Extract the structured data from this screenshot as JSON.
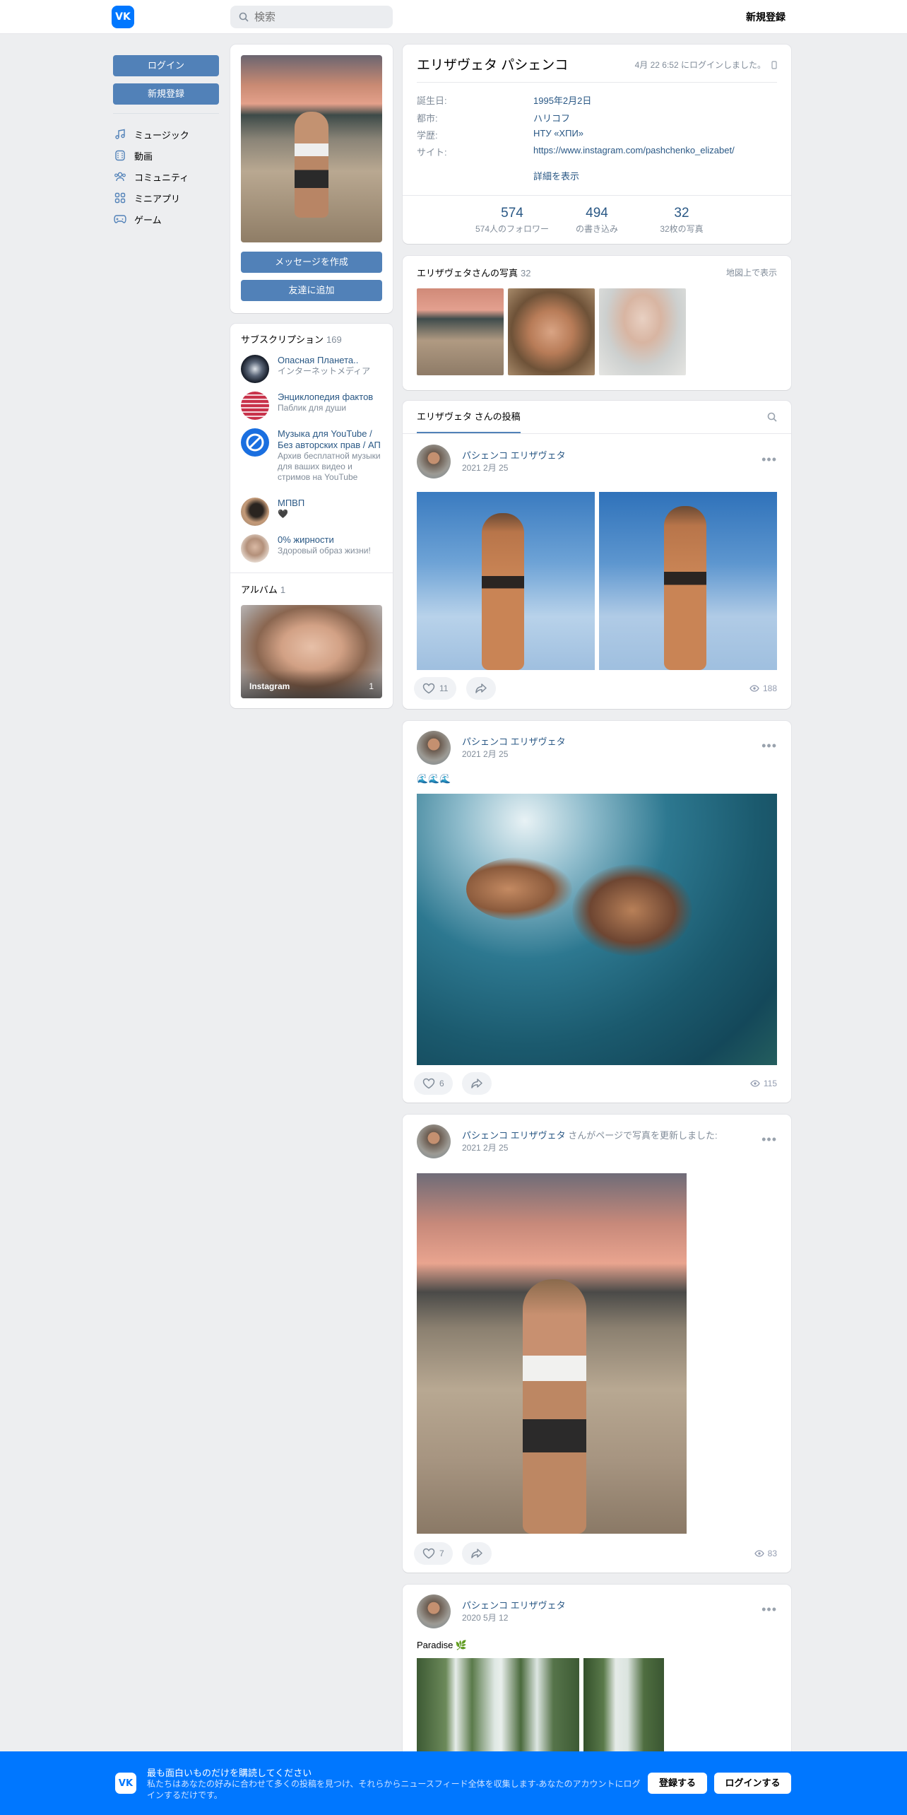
{
  "header": {
    "logo": "VK",
    "search_placeholder": "検索",
    "register": "新規登録"
  },
  "leftnav": {
    "login": "ログイン",
    "register": "新規登録",
    "items": [
      {
        "label": "ミュージック",
        "icon": "music-icon"
      },
      {
        "label": "動画",
        "icon": "video-icon"
      },
      {
        "label": "コミュニティ",
        "icon": "community-icon"
      },
      {
        "label": "ミニアプリ",
        "icon": "apps-icon"
      },
      {
        "label": "ゲーム",
        "icon": "gamepad-icon"
      }
    ]
  },
  "profile_card": {
    "message_btn": "メッセージを作成",
    "add_friend_btn": "友達に追加"
  },
  "subscriptions": {
    "title": "サブスクリプション",
    "count": "169",
    "items": [
      {
        "name": "Опасная Планета..",
        "desc": "インターネットメディア"
      },
      {
        "name": "Энциклопедия фактов",
        "desc": "Паблик для души"
      },
      {
        "name": "Музыка для YouTube / Без авторских прав / АП",
        "desc": "Архив бесплатной музыки для ваших видео и стримов на YouTube"
      },
      {
        "name": "МПВП",
        "desc": "🖤"
      },
      {
        "name": "0% жирности",
        "desc": "Здоровый образ жизни!"
      }
    ]
  },
  "albums": {
    "title": "アルバム",
    "count": "1",
    "album_name": "Instagram",
    "album_count": "1"
  },
  "profile": {
    "name": "エリザヴェタ パシェンコ",
    "online": "4月 22 6:52 にログインしました。",
    "rows": [
      {
        "key": "誕生日:",
        "value": "1995年2月2日"
      },
      {
        "key": "都市:",
        "value": "ハリコフ"
      },
      {
        "key": "学歴:",
        "value": "НТУ «ХПИ»"
      },
      {
        "key": "サイト:",
        "value": "https://www.instagram.com/pashchenko_elizabet/"
      }
    ],
    "show_more": "詳細を表示",
    "stats": [
      {
        "num": "574",
        "label": "574人のフォロワー"
      },
      {
        "num": "494",
        "label": "の書き込み"
      },
      {
        "num": "32",
        "label": "32枚の写真"
      }
    ]
  },
  "photos": {
    "title": "エリザヴェタさんの写真",
    "count": "32",
    "map_link": "地図上で表示"
  },
  "wall": {
    "tab": "エリザヴェタ さんの投稿"
  },
  "posts": [
    {
      "author": "パシェンコ エリザヴェタ",
      "author_extra": "",
      "date": "2021 2月 25",
      "text": "",
      "likes": "11",
      "views": "188"
    },
    {
      "author": "パシェンコ エリザヴェタ",
      "author_extra": "",
      "date": "2021 2月 25",
      "text": "🌊🌊🌊",
      "likes": "6",
      "views": "115"
    },
    {
      "author": "パシェンコ エリザヴェタ",
      "author_extra": " さんがページで写真を更新しました:",
      "date": "2021 2月 25",
      "text": "",
      "likes": "7",
      "views": "83"
    },
    {
      "author": "パシェンコ エリザヴェタ",
      "author_extra": "",
      "date": "2020 5月 12",
      "text": "Paradise 🌿",
      "likes": "",
      "views": ""
    }
  ],
  "banner": {
    "logo": "VK",
    "title": "最も面白いものだけを購読してください",
    "desc": "私たちはあなたの好みに合わせて多くの投稿を見つけ、それらからニュースフィード全体を収集します-あなたのアカウントにログインするだけです。",
    "register": "登録する",
    "login": "ログインする"
  },
  "colors": {
    "accent": "#0077ff",
    "button": "#5181b8",
    "link": "#2a5885",
    "background": "#edeef0"
  }
}
